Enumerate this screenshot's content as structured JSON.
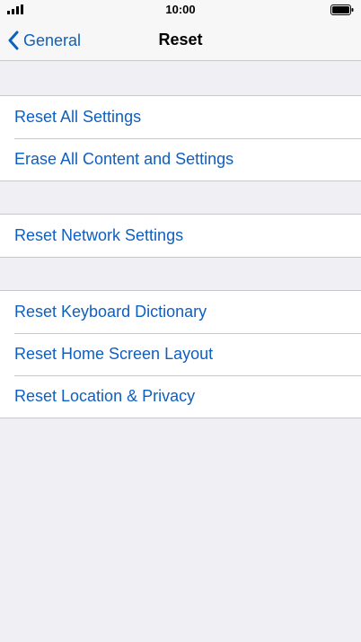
{
  "status_bar": {
    "time": "10:00",
    "signal_icon": "cellular-signal-icon",
    "battery_icon": "battery-icon"
  },
  "nav": {
    "back_label": "General",
    "back_icon": "chevron-left-icon",
    "title": "Reset"
  },
  "groups": [
    {
      "items": [
        "Reset All Settings",
        "Erase All Content and Settings"
      ]
    },
    {
      "items": [
        "Reset Network Settings"
      ]
    },
    {
      "items": [
        "Reset Keyboard Dictionary",
        "Reset Home Screen Layout",
        "Reset Location & Privacy"
      ]
    }
  ],
  "colors": {
    "accent": "#0f5fc0",
    "background": "#efeff4",
    "separator": "#c8c7cc"
  }
}
